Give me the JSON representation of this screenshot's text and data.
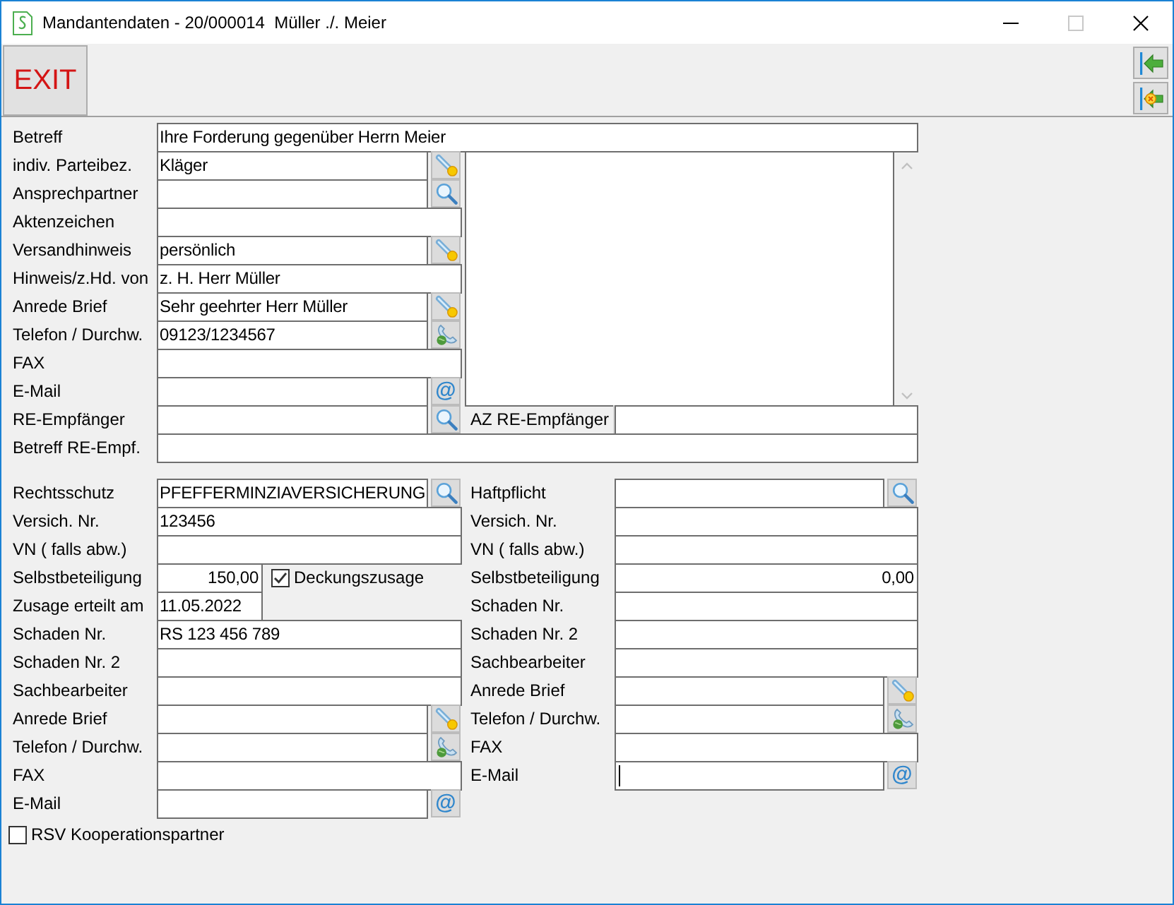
{
  "window": {
    "title": "Mandantendaten - 20/000014  Müller ./. Meier"
  },
  "toolbar": {
    "exit_button": "EXIT",
    "side_buttons": [
      {
        "kind": "back"
      },
      {
        "kind": "back-cancel"
      }
    ]
  },
  "client": {
    "subject": {
      "label": "Betreff",
      "value": "Ihre Forderung gegenüber Herrn Meier",
      "kind": "text",
      "focused": false
    },
    "rows": [
      {
        "label": "indiv. Parteibez.",
        "value": "Kläger",
        "kind": "pick",
        "focused": false
      },
      {
        "label": "Ansprechpartner",
        "kind": "search",
        "focused": false
      },
      {
        "label": "Aktenzeichen",
        "kind": "text",
        "focused": false
      },
      {
        "label": "Versandhinweis",
        "value": "persönlich",
        "kind": "pick",
        "focused": false
      },
      {
        "label": "Hinweis/z.Hd. von",
        "value": "z. H. Herr Müller",
        "kind": "text",
        "focused": false
      },
      {
        "label": "Anrede Brief",
        "value": "Sehr geehrter Herr Müller",
        "kind": "pick",
        "focused": false
      },
      {
        "label": "Telefon / Durchw.",
        "value": "09123/1234567",
        "kind": "phone",
        "focused": false
      },
      {
        "label": "FAX",
        "kind": "text",
        "focused": false
      },
      {
        "label": "E-Mail",
        "kind": "email",
        "button_label": "@",
        "focused": false
      }
    ],
    "invoice_recipient": {
      "label": "RE-Empfänger",
      "kind": "search",
      "focused": false
    },
    "invoice_recipient_ref": {
      "label": "AZ RE-Empfänger",
      "kind": "text",
      "focused": false
    },
    "invoice_subject": {
      "label": "Betreff RE-Empf.",
      "kind": "text",
      "focused": false
    }
  },
  "legal_insurance": {
    "rows": [
      {
        "label": "Rechtsschutz",
        "value": "PFEFFERMINZIAVERSICHERUNG",
        "kind": "search",
        "focused": false
      },
      {
        "label": "Versich. Nr.",
        "value": "123456",
        "kind": "text",
        "focused": false
      },
      {
        "label": "VN ( falls abw.)",
        "kind": "text",
        "focused": false
      },
      {
        "label": "Selbstbeteiligung",
        "value": "150,00",
        "kind": "amount",
        "focused": false,
        "checkbox": {
          "label": "Deckungszusage",
          "checked": true
        }
      },
      {
        "label": "Zusage erteilt am",
        "value": "11.05.2022",
        "kind": "date",
        "focused": false
      },
      {
        "label": "Schaden Nr.",
        "value": "RS 123 456 789",
        "kind": "text",
        "focused": false
      },
      {
        "label": "Schaden Nr. 2",
        "kind": "text",
        "focused": false
      },
      {
        "label": "Sachbearbeiter",
        "kind": "text",
        "focused": false
      },
      {
        "label": "Anrede Brief",
        "kind": "pick",
        "focused": false
      },
      {
        "label": "Telefon / Durchw.",
        "kind": "phone",
        "focused": false
      },
      {
        "label": "FAX",
        "kind": "text",
        "focused": false
      },
      {
        "label": "E-Mail",
        "kind": "email",
        "button_label": "@",
        "focused": false
      }
    ],
    "cooperation_partner": {
      "label": "RSV Kooperationspartner",
      "checked": false
    }
  },
  "liability_insurance": {
    "rows": [
      {
        "label": "Haftpflicht",
        "kind": "search",
        "focused": false
      },
      {
        "label": "Versich. Nr.",
        "kind": "text",
        "focused": false
      },
      {
        "label": "VN ( falls abw.)",
        "kind": "text",
        "focused": false
      },
      {
        "label": "Selbstbeteiligung",
        "value": "0,00",
        "kind": "number",
        "focused": false
      },
      {
        "label": "Schaden Nr.",
        "kind": "text",
        "focused": false
      },
      {
        "label": "Schaden Nr. 2",
        "kind": "text",
        "focused": false
      },
      {
        "label": "Sachbearbeiter",
        "kind": "text",
        "focused": false
      },
      {
        "label": "Anrede Brief",
        "kind": "pick",
        "focused": false
      },
      {
        "label": "Telefon / Durchw.",
        "kind": "phone",
        "focused": false
      },
      {
        "label": "FAX",
        "kind": "text",
        "focused": false
      },
      {
        "label": "E-Mail",
        "kind": "email",
        "button_label": "@",
        "focused": true
      }
    ]
  }
}
